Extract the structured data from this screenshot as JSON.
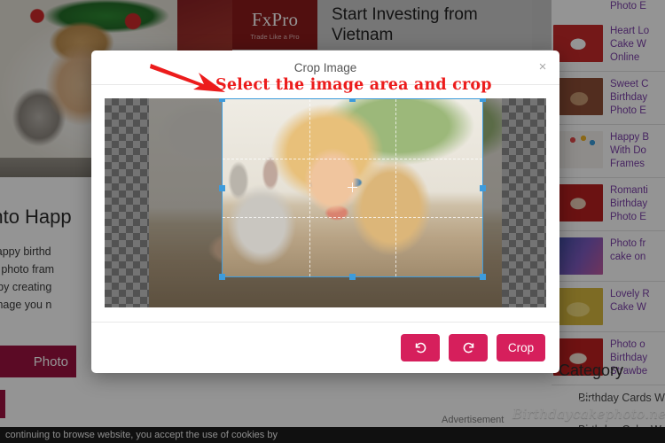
{
  "background": {
    "ad": {
      "logo_name": "FxPro",
      "logo_tagline": "Trade Like a Pro",
      "headline": "Start Investing from Vietnam",
      "label": "Advertisement"
    },
    "article": {
      "title": "s onto Happ",
      "body": "cts on happy birthd\nlay cake photo fram\nut them by creating\nad the image you n\nvice.",
      "upload_button": "Photo"
    },
    "cookie_notice": "continuing to browse website, you accept the use of cookies by",
    "watermark": "Birthdaycakephoto.net"
  },
  "sidebar": {
    "top_partial": "Photo E",
    "items": [
      {
        "thumb": "t1",
        "label": "Heart Lo\nCake W\nOnline"
      },
      {
        "thumb": "t2",
        "label": "Sweet C\nBirthday\nPhoto E"
      },
      {
        "thumb": "t3",
        "label": "Happy B\nWith Do\nFrames"
      },
      {
        "thumb": "t4",
        "label": "Romanti\nBirthday\nPhoto E"
      },
      {
        "thumb": "t5",
        "label": "Photo fr\ncake on"
      },
      {
        "thumb": "t6",
        "label": "Lovely R\nCake W"
      },
      {
        "thumb": "t7",
        "label": "Photo o\nBirthday\nStrawbe"
      }
    ],
    "category_heading": "Category",
    "category_items": [
      "Birthday Cards W",
      "Birthday Cake W"
    ]
  },
  "annotation": {
    "text": "Select the image area and crop",
    "color": "#ec1c1c",
    "arrow_icon": "red-arrow-right-icon"
  },
  "modal": {
    "title": "Crop Image",
    "close_label": "×",
    "buttons": {
      "rotate_left": {
        "name": "rotate-left-icon",
        "label": ""
      },
      "rotate_right": {
        "name": "rotate-right-icon",
        "label": ""
      },
      "crop": {
        "name": "crop-button",
        "label": "Crop"
      }
    },
    "accent_color": "#d61f5c",
    "crop_selection": {
      "handle_color": "#3d9bdc",
      "grid": true,
      "handles": 8
    }
  }
}
